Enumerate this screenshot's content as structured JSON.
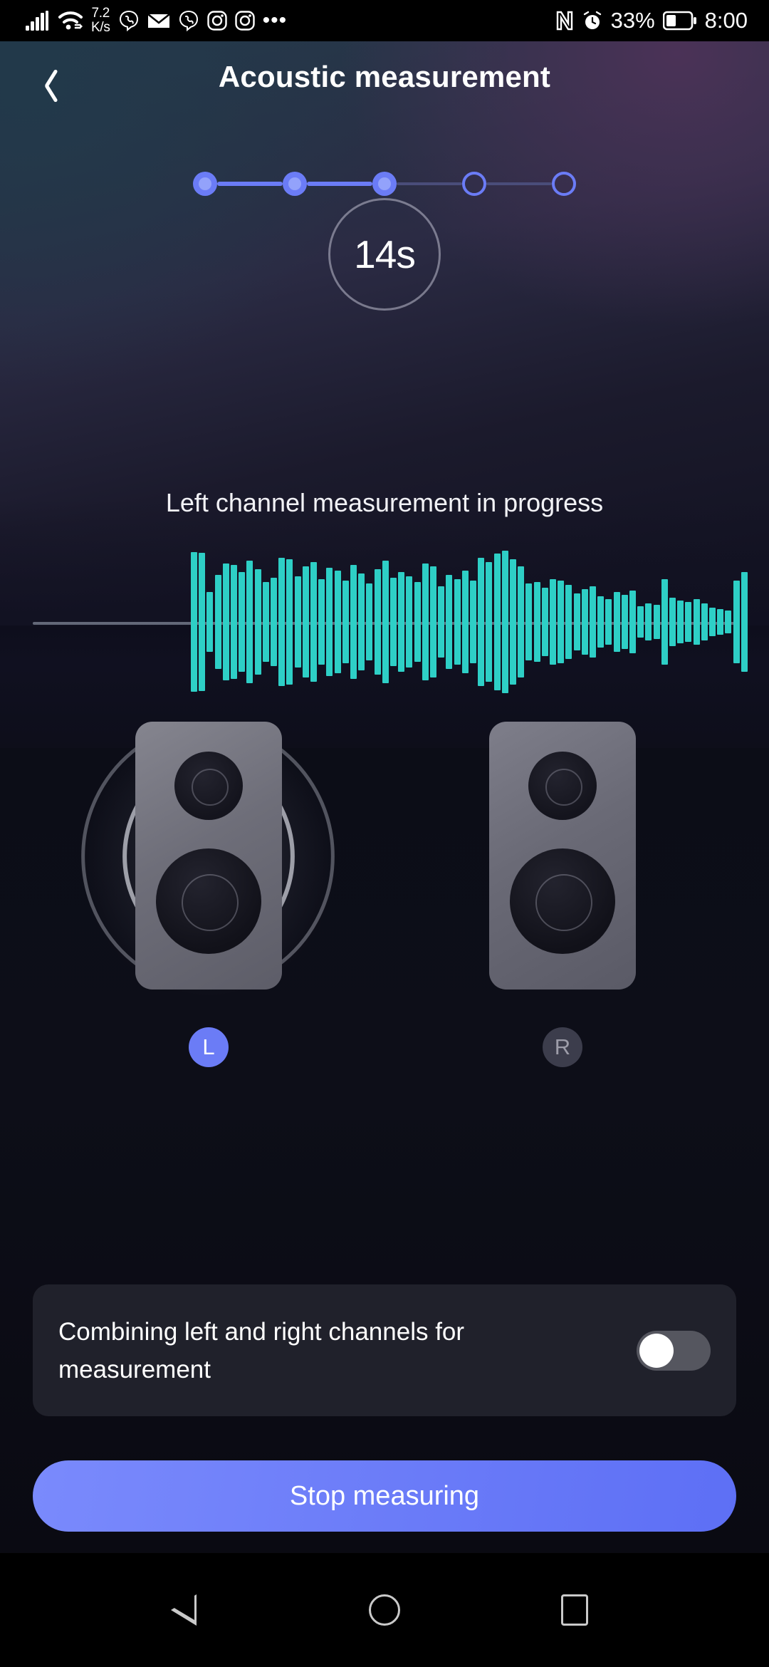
{
  "statusbar": {
    "net_speed_value": "7.2",
    "net_speed_unit": "K/s",
    "signal_icon": "cellular-signal-icon",
    "wifi_icon": "wifi-icon",
    "app_icons": [
      "viber-icon",
      "email-icon",
      "viber-icon",
      "instagram-icon",
      "instagram-icon"
    ],
    "overflow": "•••",
    "nfc_icon": "nfc-icon",
    "alarm_icon": "alarm-icon",
    "battery_percent": "33%",
    "battery_icon": "battery-icon",
    "time": "8:00"
  },
  "header": {
    "back_icon": "back-chevron-icon",
    "title": "Acoustic measurement"
  },
  "stepper": {
    "total_steps": 5,
    "current_step": 3,
    "steps": [
      {
        "state": "done"
      },
      {
        "state": "done"
      },
      {
        "state": "done"
      },
      {
        "state": "todo"
      },
      {
        "state": "todo"
      }
    ],
    "connector_states": [
      "on",
      "on",
      "off",
      "off"
    ],
    "active_color": "#6b7cf6",
    "inactive_color": "#4a4d7a"
  },
  "timer": {
    "value": "14s",
    "ring_color": "#bebecd"
  },
  "status_text": "Left channel measurement in progress",
  "waveform": {
    "baseline_color": "#636878",
    "bar_color": "#2ecfc6",
    "amplitudes": [
      0.98,
      0.97,
      0.42,
      0.66,
      0.82,
      0.8,
      0.7,
      0.86,
      0.74,
      0.56,
      0.62,
      0.9,
      0.88,
      0.64,
      0.78,
      0.84,
      0.6,
      0.76,
      0.72,
      0.58,
      0.8,
      0.68,
      0.54,
      0.74,
      0.86,
      0.62,
      0.7,
      0.64,
      0.56,
      0.82,
      0.78,
      0.5,
      0.66,
      0.6,
      0.72,
      0.58,
      0.9,
      0.84,
      0.96,
      1.0,
      0.88,
      0.78,
      0.54,
      0.56,
      0.48,
      0.6,
      0.58,
      0.52,
      0.4,
      0.46,
      0.5,
      0.36,
      0.32,
      0.42,
      0.38,
      0.44,
      0.22,
      0.26,
      0.24,
      0.6,
      0.34,
      0.3,
      0.28,
      0.32,
      0.26,
      0.2,
      0.18,
      0.16,
      0.58,
      0.7
    ]
  },
  "speakers": {
    "left": {
      "label": "L",
      "active": true,
      "icon": "speaker-icon",
      "sound_wave_icon": "sound-waves-icon"
    },
    "right": {
      "label": "R",
      "active": false,
      "icon": "speaker-icon"
    },
    "active_badge_color": "#6b7cf6",
    "inactive_badge_color": "#3c3d4c"
  },
  "combine_setting": {
    "label": "Combining left and right channels for measurement",
    "toggle_state": "off"
  },
  "cta": {
    "label": "Stop measuring",
    "color": "#6a7bf8"
  },
  "navbar": {
    "back": "nav-back-icon",
    "home": "nav-home-icon",
    "recents": "nav-recents-icon"
  }
}
